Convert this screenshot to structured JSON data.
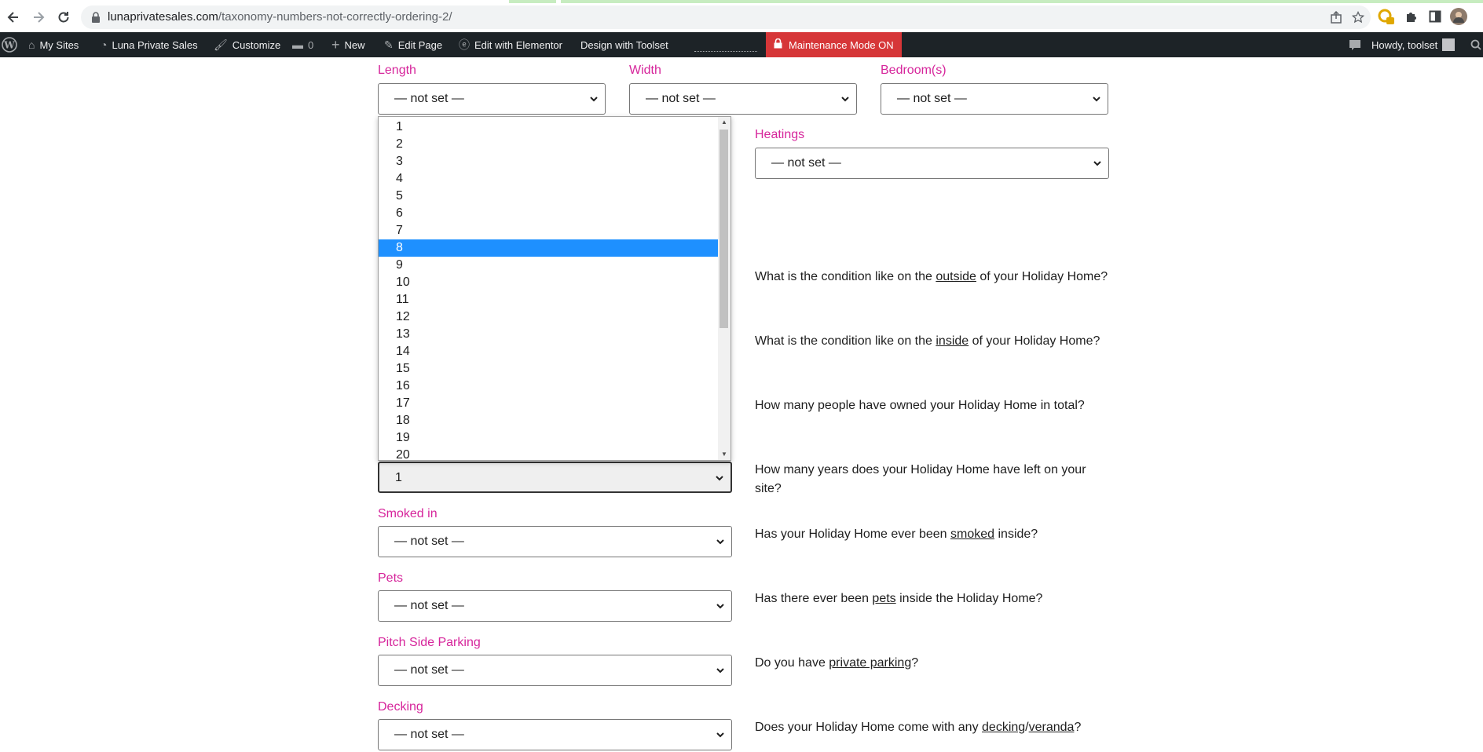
{
  "browser": {
    "url_host": "lunaprivatesales.com",
    "url_path": "/taxonomy-numbers-not-correctly-ordering-2/"
  },
  "adminbar": {
    "my_sites": "My Sites",
    "site_name": "Luna Private Sales",
    "customize": "Customize",
    "comments_count": "0",
    "new": "New",
    "edit_page": "Edit Page",
    "edit_elementor": "Edit with Elementor",
    "design_toolset": "Design with Toolset",
    "maintenance": "Maintenance Mode ON",
    "howdy": "Howdy, toolset"
  },
  "form": {
    "length": {
      "label": "Length",
      "value": "— not set —"
    },
    "width": {
      "label": "Width",
      "value": "— not set —"
    },
    "bedrooms": {
      "label": "Bedroom(s)",
      "value": "— not set —"
    },
    "heatings": {
      "label": "Heatings",
      "value": "— not set —"
    },
    "years_left": {
      "value": "1"
    },
    "smoked": {
      "label": "Smoked in",
      "value": "— not set —"
    },
    "pets": {
      "label": "Pets",
      "value": "— not set —"
    },
    "parking": {
      "label": "Pitch Side Parking",
      "value": "— not set —"
    },
    "decking": {
      "label": "Decking",
      "value": "— not set —"
    }
  },
  "questions": {
    "outside": {
      "pre": "What is the condition like on the ",
      "u": "outside",
      "post": " of your Holiday Home?"
    },
    "inside": {
      "pre": "What is the condition like on the ",
      "u": "inside",
      "post": " of your Holiday Home?"
    },
    "owners": {
      "text": "How many people have owned your Holiday Home in total?"
    },
    "years": {
      "text": "How many years does your Holiday Home have left on your site?"
    },
    "smoked": {
      "pre": "Has your Holiday Home ever been ",
      "u": "smoked",
      "post": " inside?"
    },
    "pets": {
      "pre": "Has there ever been ",
      "u": "pets",
      "post": " inside the Holiday Home?"
    },
    "parking": {
      "pre": "Do you have ",
      "u": "private parking",
      "post": "?"
    },
    "decking": {
      "pre": "Does your Holiday Home come with any ",
      "u": "decking",
      "mid": "/",
      "u2": "veranda",
      "post": "?"
    }
  },
  "dropdown": {
    "options": [
      "1",
      "2",
      "3",
      "4",
      "5",
      "6",
      "7",
      "8",
      "9",
      "10",
      "11",
      "12",
      "13",
      "14",
      "15",
      "16",
      "17",
      "18",
      "19",
      "20"
    ],
    "highlighted": "8"
  },
  "colors": {
    "label_pink": "#d6259b",
    "highlight_blue": "#1e90ff",
    "adminbar_bg": "#1d2327",
    "maintenance_red": "#d63638"
  }
}
